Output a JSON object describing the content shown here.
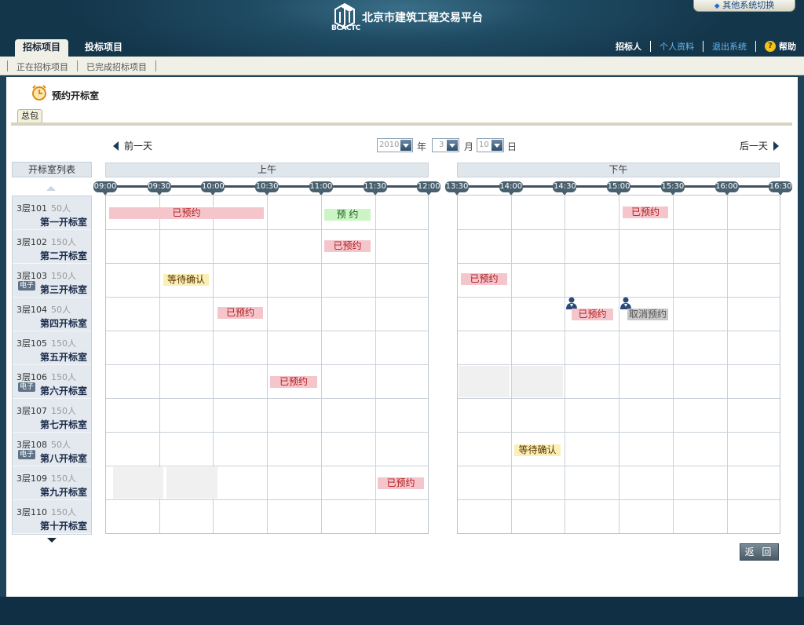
{
  "header": {
    "site_title": "北京市建筑工程交易平台",
    "logo_text": "BCACTC",
    "switch_label": "其他系统切换",
    "main_tabs": [
      "招标项目",
      "投标项目"
    ],
    "role": "招标人",
    "links": [
      "个人资料",
      "退出系统"
    ],
    "help": "帮助"
  },
  "subnav": {
    "items": [
      "正在招标项目",
      "已完成招标项目"
    ]
  },
  "page": {
    "title": "预约开标室",
    "tab": "总包"
  },
  "date_nav": {
    "prev": "前一天",
    "next": "后一天",
    "year": "2010",
    "year_unit": "年",
    "month": "3",
    "month_unit": "月",
    "day": "10",
    "day_unit": "日"
  },
  "room_list": {
    "header": "开标室列表",
    "rooms": [
      {
        "code": "3层101",
        "capacity": "50人",
        "name": "第一开标室",
        "electronic": false
      },
      {
        "code": "3层102",
        "capacity": "150人",
        "name": "第二开标室",
        "electronic": false
      },
      {
        "code": "3层103",
        "capacity": "150人",
        "name": "第三开标室",
        "electronic": true
      },
      {
        "code": "3层104",
        "capacity": "50人",
        "name": "第四开标室",
        "electronic": false
      },
      {
        "code": "3层105",
        "capacity": "150人",
        "name": "第五开标室",
        "electronic": false
      },
      {
        "code": "3层106",
        "capacity": "150人",
        "name": "第六开标室",
        "electronic": true
      },
      {
        "code": "3层107",
        "capacity": "150人",
        "name": "第七开标室",
        "electronic": false
      },
      {
        "code": "3层108",
        "capacity": "50人",
        "name": "第八开标室",
        "electronic": true
      },
      {
        "code": "3层109",
        "capacity": "150人",
        "name": "第九开标室",
        "electronic": false
      },
      {
        "code": "3层110",
        "capacity": "150人",
        "name": "第十开标室",
        "electronic": false
      }
    ],
    "electronic_tag": "电子"
  },
  "schedule": {
    "morning_label": "上午",
    "afternoon_label": "下午",
    "morning_times": [
      "09:00",
      "09:30",
      "10:00",
      "10:30",
      "11:00",
      "11:30",
      "12:00"
    ],
    "afternoon_times": [
      "13:30",
      "14:00",
      "14:30",
      "15:00",
      "15:30",
      "16:00",
      "16:30"
    ],
    "labels": {
      "booked": "已预约",
      "reserve": "预  约",
      "pending": "等待确认",
      "cancel": "取消预约"
    }
  },
  "return_label": "返 回",
  "colors": {
    "booked_bg": "#f5c5cc",
    "reserve_bg": "#cbf5c5",
    "pending_bg": "#fbefb6",
    "cancel_bg": "#c8c8c8",
    "header_bg": "#1f4b63"
  }
}
